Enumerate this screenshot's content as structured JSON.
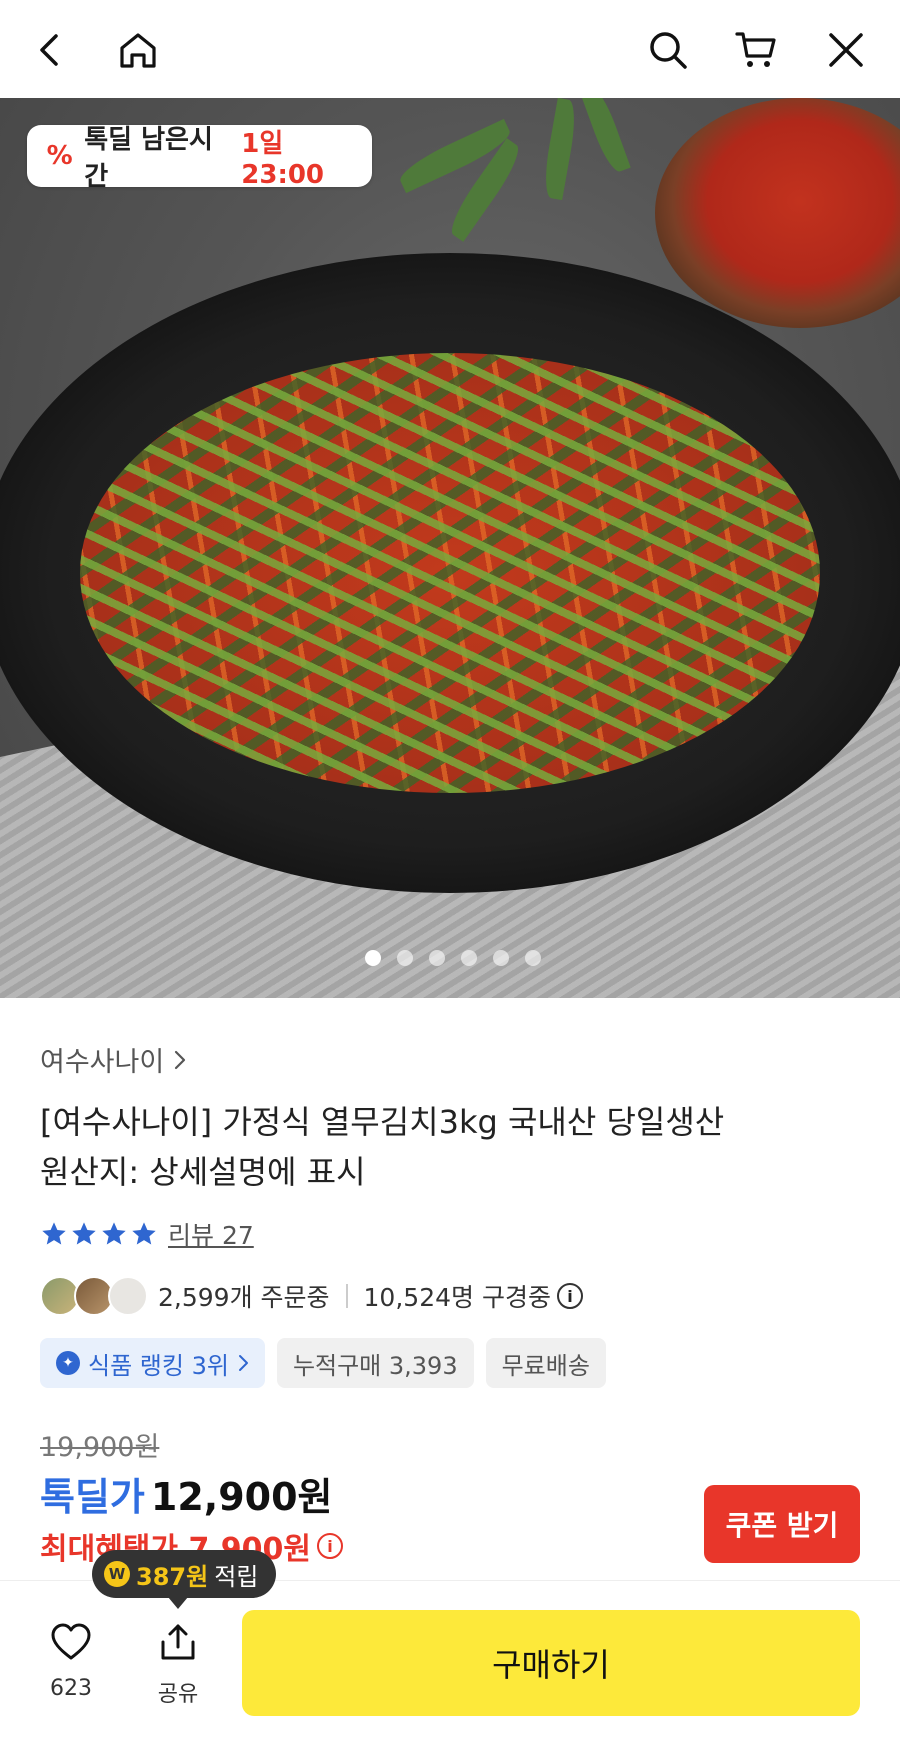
{
  "top_bar": {
    "icons": [
      "back-icon",
      "home-icon",
      "search-icon",
      "cart-icon",
      "close-icon"
    ]
  },
  "hero": {
    "timer_label": "톡딜 남은시간",
    "timer_value": "1일 23:00",
    "image_count": 6,
    "active_index": 0
  },
  "product": {
    "seller": "여수사나이",
    "title_line1": "[여수사나이] 가정식 열무김치3kg 국내산 당일생산",
    "title_line2": "원산지: 상세설명에 표시",
    "rating_stars": 4,
    "review_label": "리뷰 27",
    "ordering_text": "2,599개 주문중",
    "browsing_text": "10,524명 구경중",
    "chips": {
      "rank": "식품 랭킹 3위",
      "cumulative": "누적구매 3,393",
      "shipping": "무료배송"
    },
    "original_price": "19,900원",
    "deal_label": "톡딜가",
    "deal_price": "12,900원",
    "max_benefit": "최대혜택가 7,900원",
    "coupon_button": "쿠폰 받기"
  },
  "bottom_bar": {
    "reward_amount": "387원",
    "reward_text": "적립",
    "like_count": "623",
    "share_label": "공유",
    "buy_button": "구매하기"
  },
  "colors": {
    "accent_red": "#e8362a",
    "deal_blue": "#2f6de0",
    "buy_yellow": "#fde93a"
  }
}
